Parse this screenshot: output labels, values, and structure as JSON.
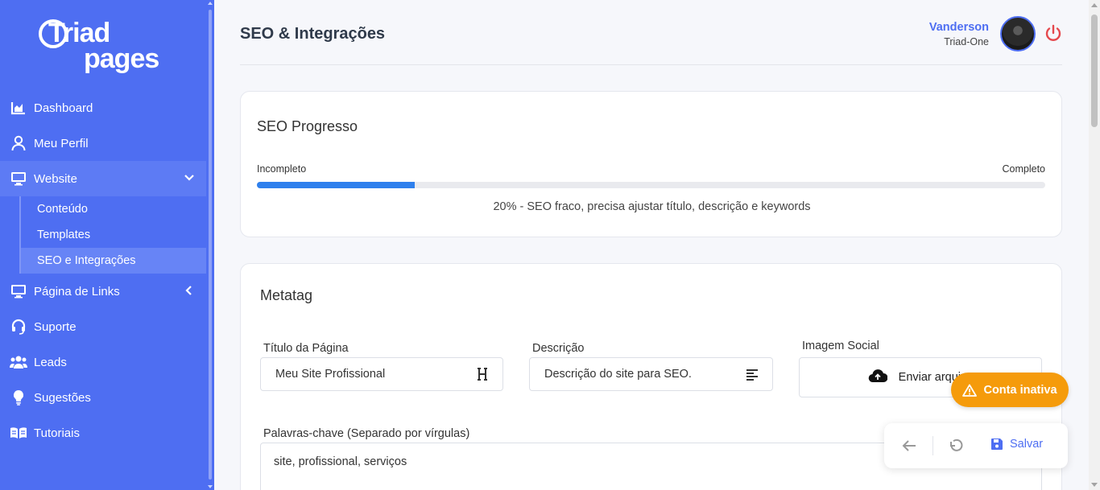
{
  "brand": {
    "line1": "Triad",
    "line2": "pages"
  },
  "sidebar": {
    "items": [
      {
        "label": "Dashboard",
        "icon": "chart-area-icon"
      },
      {
        "label": "Meu Perfil",
        "icon": "user-icon"
      },
      {
        "label": "Website",
        "icon": "monitor-icon"
      },
      {
        "label": "Página de Links",
        "icon": "monitor-icon"
      },
      {
        "label": "Suporte",
        "icon": "headset-icon"
      },
      {
        "label": "Leads",
        "icon": "users-icon"
      },
      {
        "label": "Sugestões",
        "icon": "lightbulb-icon"
      },
      {
        "label": "Tutoriais",
        "icon": "book-icon"
      }
    ],
    "website_sub": [
      {
        "label": "Conteúdo"
      },
      {
        "label": "Templates"
      },
      {
        "label": "SEO e Integrações"
      }
    ]
  },
  "header": {
    "title": "SEO & Integrações",
    "user_name": "Vanderson",
    "user_org": "Triad-One"
  },
  "seo_progress": {
    "title": "SEO Progresso",
    "label_left": "Incompleto",
    "label_right": "Completo",
    "percent": 20,
    "status_text": "20% - SEO fraco, precisa ajustar título, descrição e keywords"
  },
  "metatag": {
    "title": "Metatag",
    "page_title_label": "Título da Página",
    "page_title_value": "Meu Site Profissional",
    "description_label": "Descrição",
    "description_value": "Descrição do site para SEO.",
    "social_image_label": "Imagem Social",
    "upload_label": "Enviar arquivo",
    "keywords_label": "Palavras-chave (Separado por vírgulas)",
    "keywords_value": "site, profissional, serviços"
  },
  "floating": {
    "inactive_label": "Conta inativa",
    "save_label": "Salvar"
  },
  "colors": {
    "sidebar": "#4e6ef2",
    "progress": "#2f80ed",
    "warning": "#f59b0b",
    "power": "#e5484d"
  }
}
